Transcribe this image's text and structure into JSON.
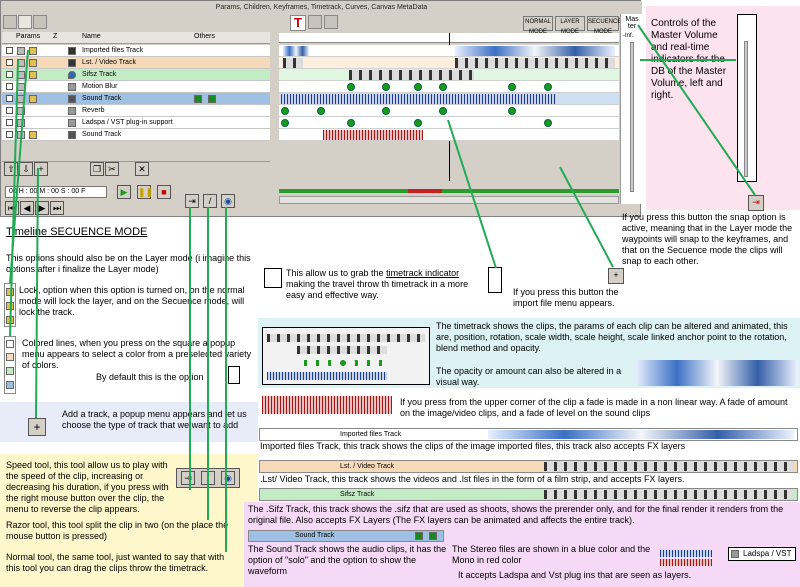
{
  "window": {
    "title": "Params, Children, Keyframes, Timetrack, Curves, Canvas MetaData",
    "timetrack_tab": "T",
    "mode_buttons": [
      "NORMAL MODE",
      "LAYER MODE",
      "SECUENCE MODE"
    ],
    "master_label": "Mas ter",
    "master_db": "-Inf."
  },
  "columns": {
    "params": "Params",
    "z": "Z",
    "name": "Name",
    "others": "Others"
  },
  "tracks": [
    {
      "name": "Imported files Track",
      "bg": "#ffffff"
    },
    {
      "name": "Lst. / Video Track",
      "bg": "#f6d9b8"
    },
    {
      "name": "Sifsz Track",
      "bg": "#c4ecc4"
    },
    {
      "name": "Motion Blur",
      "bg": "#ffffff"
    },
    {
      "name": "Sound Track",
      "bg": "#9ec1e3"
    },
    {
      "name": "Reverb",
      "bg": "#ffffff"
    },
    {
      "name": "Ladspa / VST plug-in support",
      "bg": "#ffffff"
    },
    {
      "name": "Sound Track",
      "bg": "#ffffff"
    }
  ],
  "timecode": {
    "h": "00",
    "m": "00",
    "s": "00",
    "f": "00",
    "h_label": "H :",
    "m_label": "M :",
    "s_label": "S :",
    "f_label": "F"
  },
  "annotations": {
    "timeline_title": "Timeline SECUENCE MODE",
    "layer_mode_note": "This options should also be on the Layer mode (i imagine this options after i finalize the Layer mode)",
    "lock": "Lock, option when this option is turned on, on the normal mode will lock the layer, and on the Secuence mode, will lock the track.",
    "colored_lines": "Colored lines, when you press on the square a popup menu appears to select a color from a preselected variety of colors.",
    "default": "By default this is the option",
    "add_track": "Add a track, a popup menu appears and let us choose the type of track that we want to add",
    "speed_tool": "Speed tool, this tool allow us to play with the speed of the clip, increasing or decreasing his duration, if you press with the right mouse button over the clip, the menu to reverse the clip appears.",
    "razor_tool": "Razor tool, this tool split the clip in two (on the place the mouse button is pressed)",
    "normal_tool": "Normal tool, the same tool, just wanted to say that with this tool you can drag the clips throw the timetrack.",
    "master_volume": "Controls of the Master Volume and real-time indicators for the DB of the Master Volume, left and right.",
    "snap": "If you press this button the snap option is active, meaning that in the Layer mode the waypoints will snap to the keyframes, and that on the Secuence mode the clips will snap to each other.",
    "grab_prefix": "This allow us to grab the",
    "grab_link": "timetrack indicator",
    "grab_rest": "making the travel throw th timetrack in a more easy and effective way.",
    "import_menu": "If you press this button the import file menu appears.",
    "timetrack": "The timetrack shows the clips, the params of each clip can be altered and animated, this are, position, rotation, scale width, scale height, scale linked anchor point to the rotation, blend method and opacity.",
    "opacity": "The opacity or amount can also be altered in a visual way.",
    "fade": "If you press from the upper corner of the clip a fade is made in a non linear way. A fade of amount on the image/video clips, and a fade of level on the sound clips",
    "imported_files": "Imported files Track, this track shows the clips of the image imported files, this track also accepts FX layers",
    "lst_video": ".Lst/ Video Track, this track shows the videos and .lst files in the form of a film strip, and accepts FX layers.",
    "sifz": "The .Sifz Track, this track shows the .sifz that are used as shoots, shows the prerender only, and for the final render it renders from the original file. Also accepts FX Layers (The FX layers can be animated and affects the entire track).",
    "sound_track": "The Sound Track shows the audio clips, it has the option of \"solo\" and the option to show the waveform",
    "stereo": "The Stereo files are shown in a blue color and the Mono in red color",
    "ladspa": "It accepts Ladspa and Vst plug ins that are seen as layers."
  },
  "strips": {
    "imported": "Imported files Track",
    "lst": "Lst. / Video Track",
    "sifz": "Sifsz Track",
    "sound": "Sound Track",
    "ladspa": "Ladspa / VST"
  },
  "colors": {
    "accent_arrow": "#22aa55",
    "stereo": "#1d3b88",
    "mono": "#a01818"
  }
}
